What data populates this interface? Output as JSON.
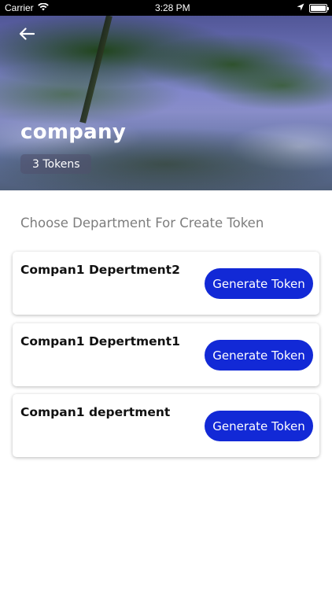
{
  "status_bar": {
    "carrier": "Carrier",
    "time": "3:28 PM",
    "icons": [
      "wifi-icon",
      "location-icon",
      "battery-icon"
    ]
  },
  "header": {
    "title": "company",
    "tokens_badge": "3 Tokens",
    "back_icon": "back-arrow-icon"
  },
  "section": {
    "heading": "Choose Department For Create Token"
  },
  "departments": [
    {
      "name": "Compan1 Depertment2",
      "button_label": "Generate Token"
    },
    {
      "name": "Compan1 Depertment1",
      "button_label": "Generate Token"
    },
    {
      "name": "Compan1 depertment",
      "button_label": "Generate Token"
    }
  ],
  "colors": {
    "accent": "#1229d6",
    "heading_text": "#7d7d7d",
    "status_bar_bg": "#000000"
  }
}
